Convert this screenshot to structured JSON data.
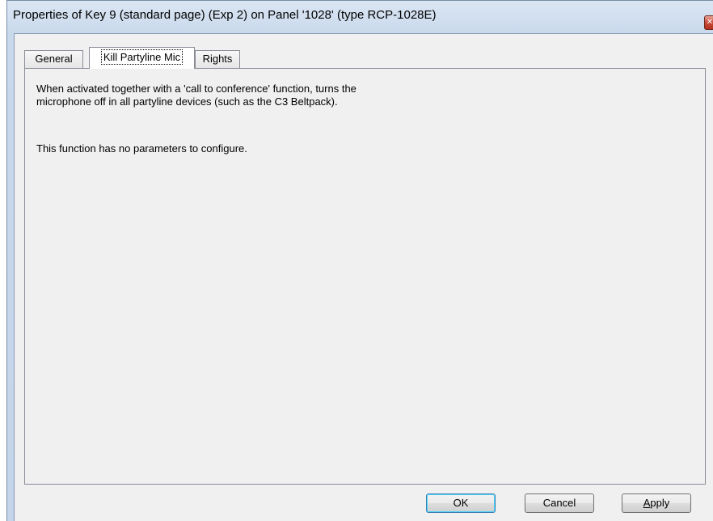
{
  "window": {
    "title": "Properties of Key 9 (standard page) (Exp 2) on Panel '1028' (type RCP-1028E)"
  },
  "tabs": [
    {
      "label": "General",
      "active": false
    },
    {
      "label": "Kill Partyline Mic",
      "active": true
    },
    {
      "label": "Rights",
      "active": false
    }
  ],
  "panel": {
    "description_line1": "When activated together with a 'call to conference' function, turns the",
    "description_line2": "microphone off in all partyline devices (such as the C3 Beltpack).",
    "no_params": "This function has no parameters to configure."
  },
  "buttons": {
    "ok": "OK",
    "cancel": "Cancel",
    "apply_accel": "A",
    "apply_rest": "pply"
  },
  "colors": {
    "titlebar": "#c9d9ec",
    "close_button": "#c74a35",
    "dialog_background": "#f0f0f0",
    "default_button_border": "#3c7fb1"
  },
  "icons": {
    "close": "close-icon"
  }
}
